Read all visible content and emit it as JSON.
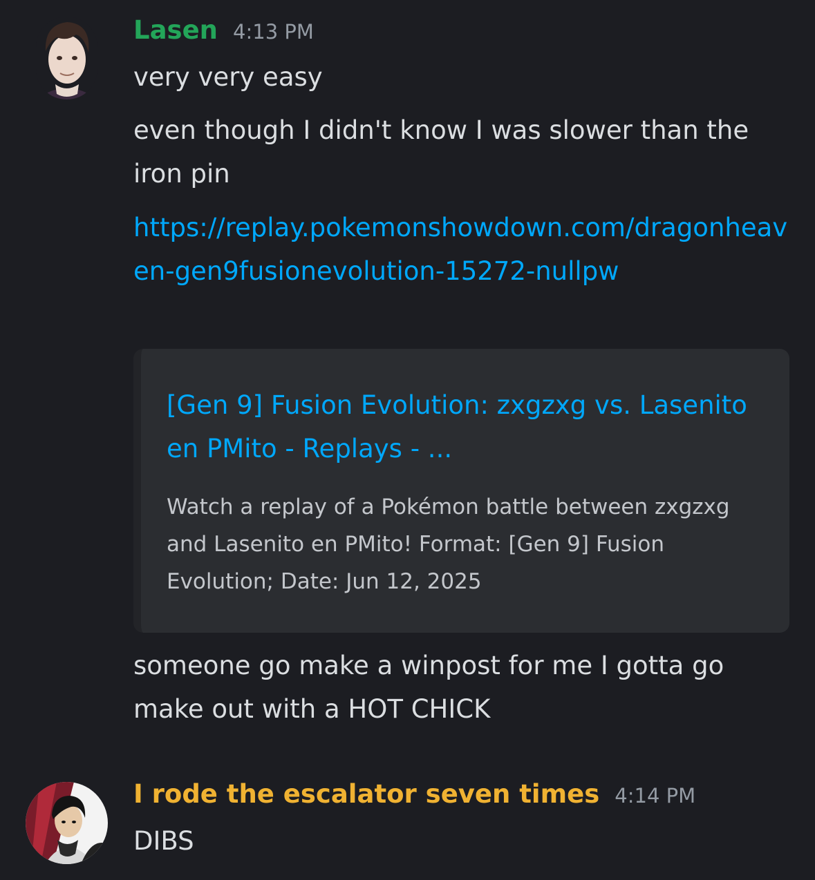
{
  "messages": [
    {
      "author": "Lasen",
      "author_color": "#23a559",
      "timestamp": "4:13 PM",
      "lines": [
        "very very easy",
        "even though I didn't know I was slower than the iron pin",
        "https://replay.pokemonshowdown.com/dragonheaven-gen9fusionevolution-15272-nullpw",
        "someone go make a winpost for me I gotta go make out with a HOT CHICK"
      ],
      "embed": {
        "title": "[Gen 9] Fusion Evolution: zxgzxg vs. Lasenito en PMito - Replays - ...",
        "description": "Watch a replay of a Pokémon battle between zxgzxg and Lasenito en PMito! Format: [Gen 9] Fusion Evolution; Date: Jun 12, 2025"
      }
    },
    {
      "author": "I rode the escalator seven times",
      "author_color": "#f0b232",
      "timestamp": "4:14 PM",
      "lines": [
        "DIBS"
      ]
    }
  ],
  "colors": {
    "background": "#1c1d22",
    "link": "#00a8fc",
    "embed_bg": "#2b2d31"
  }
}
